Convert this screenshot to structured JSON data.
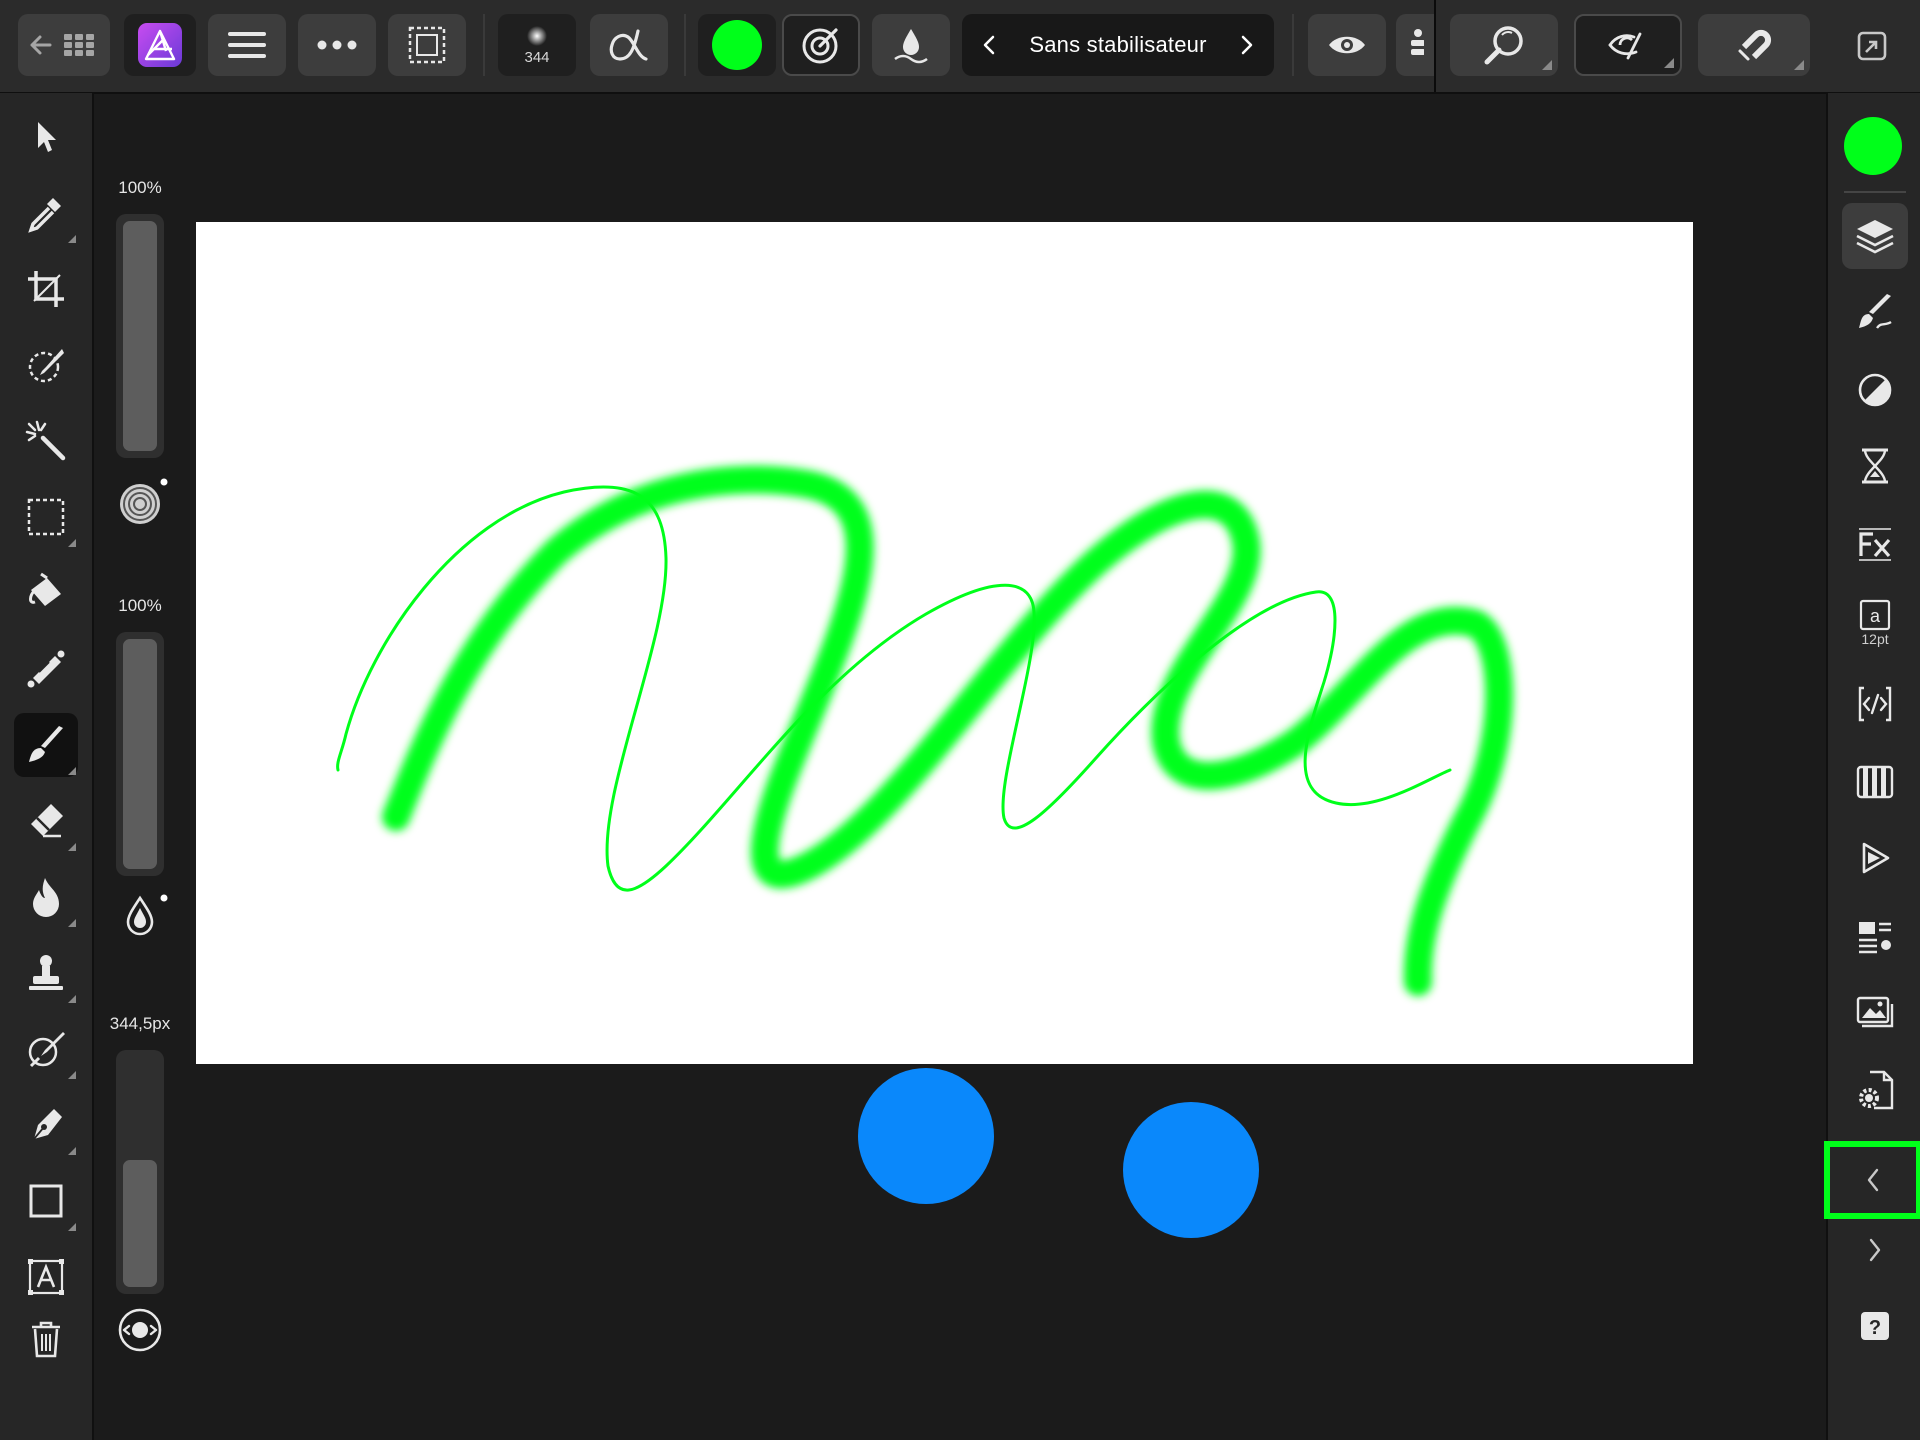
{
  "app": {
    "name": "Affinity Photo"
  },
  "toolbar": {
    "brush_size_value": "344",
    "stabilizer_label": "Sans stabilisateur",
    "primary_color": "#00ff1a"
  },
  "sliders": {
    "opacity_label": "100%",
    "opacity_fraction": 1.0,
    "flow_label": "100%",
    "flow_fraction": 1.0,
    "size_label": "344,5px",
    "size_fraction": 0.55
  },
  "right_panel": {
    "text_style_size": "12pt",
    "accent_color": "#00ff1a"
  },
  "colors": {
    "stroke_green": "#00ff1a",
    "touch_indicator": "#0a88fb",
    "highlight_outline": "#00ff1a"
  }
}
